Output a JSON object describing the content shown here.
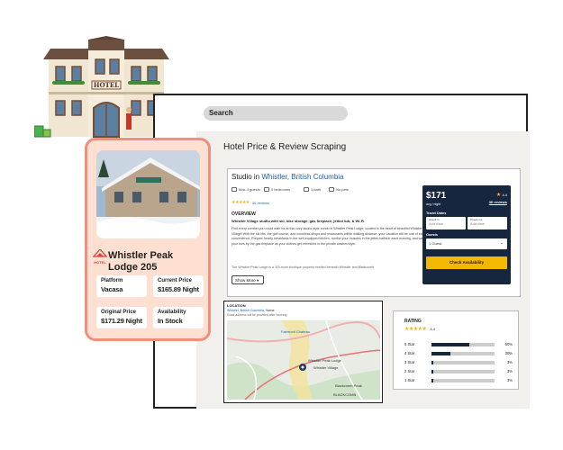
{
  "search": {
    "label": "Search"
  },
  "page": {
    "title": "Hotel Price & Review Scraping"
  },
  "listing": {
    "title_prefix": "Studio in ",
    "title_location": "Whistler, British Columbia",
    "amenities": [
      {
        "icon": "guests-icon",
        "label": "Max 4 guests"
      },
      {
        "icon": "bed-icon",
        "label": "0 bedrooms"
      },
      {
        "icon": "bath-icon",
        "label": "1 bath"
      },
      {
        "icon": "no-pets-icon",
        "label": "No pets"
      }
    ],
    "stars": "★★★★★",
    "reviews_link": "30 reviews",
    "overview_heading": "OVERVIEW",
    "description_heading": "Whistler Village studio with ski, bike storage, gas fireplace, jetted tub, & Wi-Fi",
    "description": "Find every comfort you could wish for at this cozy studio-style condo in Whistler Peak Lodge, located in the heart of beautiful Whistler Village! With the ski lifts, the golf course, and countless shops and restaurants within walking distance, your vacation will be one of ease and convenience. Prepare hearty breakfasts in the well-equipped kitchen, soothe your muscles in the jetted bathtub each evening, and warm your toes by the gas fireplace as your clothes get refreshed in the private washer/dryer.",
    "description_more": "The Whistler Peak Lodge is a 115-room boutique property nestled beneath Whistler and Blackcomb",
    "show_more": "Show More ▾"
  },
  "booking": {
    "price": "$171",
    "price_unit": "avg / night",
    "rating": "4.4",
    "reviews": "30 reviews",
    "travel_label": "Travel Dates",
    "check_in_label": "Check in",
    "check_in_value": "Add date",
    "check_out_label": "Check out",
    "check_out_value": "Add date",
    "guests_label": "Guests",
    "guests_value": "1 Guest",
    "cta": "Check Availability",
    "accent": "#f5b800",
    "panel_color": "#16263f"
  },
  "location": {
    "heading": "LOCATION",
    "place_link": "Whistler, British Columbia",
    "place_suffix": ", Home",
    "note": "Exact address will be provided after booking",
    "map_labels": [
      "Whistler Peak Lodge",
      "Whistler Village",
      "Blackcomb Peak",
      "BLACKCOMB",
      "Fairmont Chateau"
    ]
  },
  "rating": {
    "heading": "RATING",
    "stars": "★★★★★",
    "average": "4.4",
    "breakdown": [
      {
        "label": "5 Star",
        "value": 60,
        "pct": "60%"
      },
      {
        "label": "4 Star",
        "value": 30,
        "pct": "30%"
      },
      {
        "label": "3 Star",
        "value": 3,
        "pct": "3%"
      },
      {
        "label": "2 Star",
        "value": 3,
        "pct": "3%"
      },
      {
        "label": "1 Star",
        "value": 3,
        "pct": "3%"
      }
    ]
  },
  "hotel_card": {
    "logo_text": "HOTEL",
    "name_line1": "Whistler Peak",
    "name_line2": "Lodge 205",
    "platform_label": "Platform",
    "platform_value": "Vacasa",
    "current_label": "Current Price",
    "current_value": "$165.89 Night",
    "original_label": "Original Price",
    "original_value": "$171.29 Night",
    "availability_label": "Availability",
    "availability_value": "In Stock",
    "border_color": "#f0907c"
  },
  "illustration": {
    "sign": "HOTEL"
  }
}
